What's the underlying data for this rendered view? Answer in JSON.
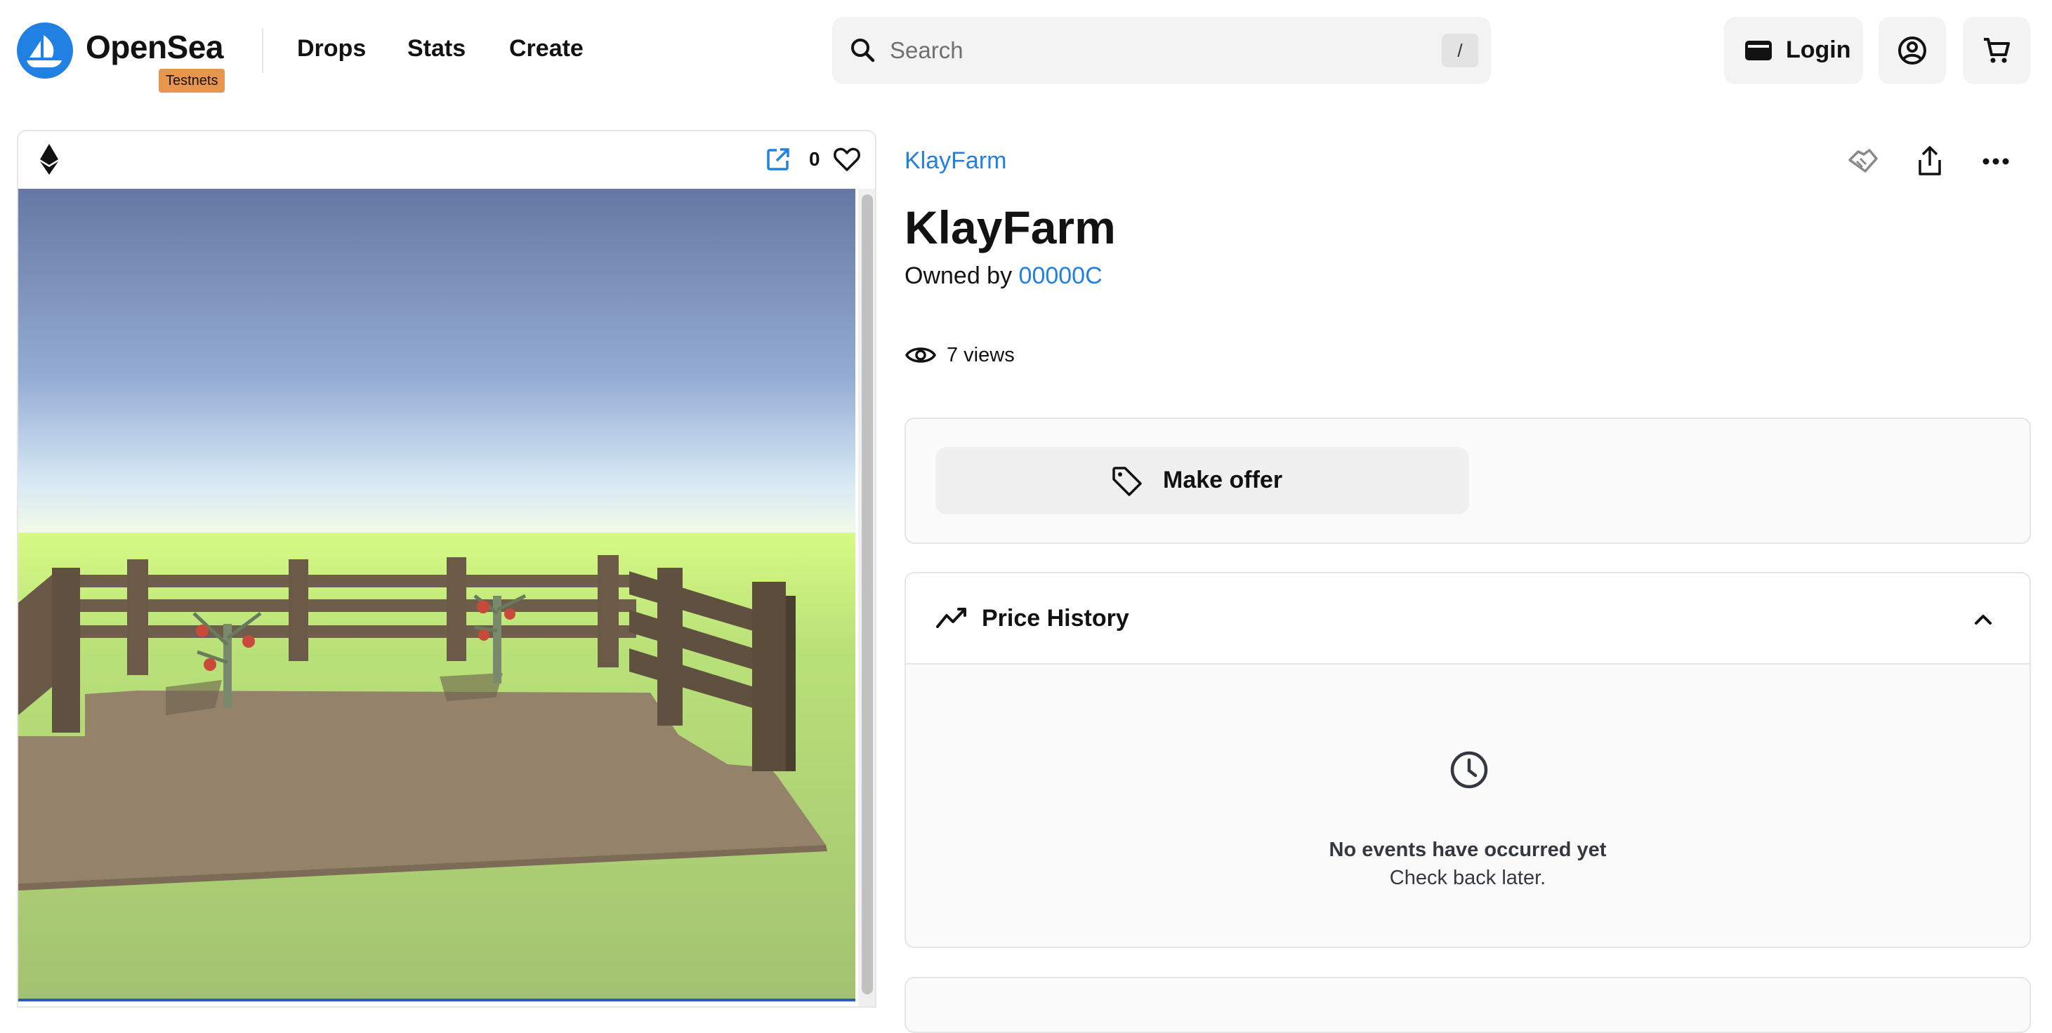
{
  "header": {
    "logo_text": "OpenSea",
    "badge": "Testnets",
    "nav": [
      "Drops",
      "Stats",
      "Create"
    ],
    "search": {
      "placeholder": "Search",
      "shortcut": "/"
    },
    "login_label": "Login",
    "icons": [
      "opensea-logo-icon",
      "search-icon",
      "wallet-icon",
      "account-icon",
      "cart-icon"
    ]
  },
  "media": {
    "chain_icon": "ethereum-icon",
    "favorite_count": "0",
    "icons": [
      "external-link-icon",
      "heart-icon"
    ]
  },
  "item": {
    "collection": "KlayFarm",
    "title": "KlayFarm",
    "owned_by_label": "Owned by",
    "owner": "00000C",
    "views": "7 views",
    "action_icons": [
      "offer-handshake-icon",
      "share-icon",
      "more-icon"
    ]
  },
  "offer": {
    "label": "Make offer",
    "icon": "tag-icon"
  },
  "price_history": {
    "title": "Price History",
    "empty_title": "No events have occurred yet",
    "empty_sub": "Check back later."
  },
  "colors": {
    "accent": "#2081e2",
    "badge": "#e8954e",
    "text": "#121212",
    "border": "#e5e5e5"
  }
}
